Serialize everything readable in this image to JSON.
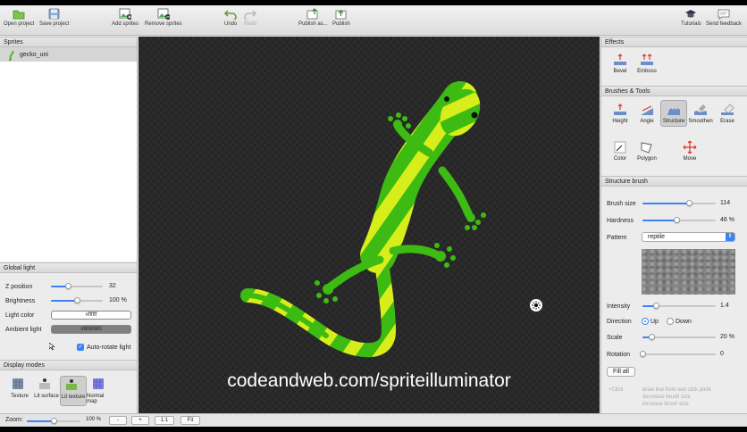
{
  "toolbar": {
    "open_project": "Open project",
    "save_project": "Save project",
    "add_sprites": "Add sprites",
    "remove_sprites": "Remove sprites",
    "undo": "Undo",
    "redo": "Redo",
    "publish_as": "Publish as...",
    "publish": "Publish",
    "tutorials": "Tutorials",
    "send_feedback": "Send feedback"
  },
  "sprites": {
    "header": "Sprites",
    "items": [
      {
        "label": "gecko_uni"
      }
    ]
  },
  "global_light": {
    "header": "Global light",
    "z_position": {
      "label": "Z position",
      "value": "32",
      "level": 0.32
    },
    "brightness": {
      "label": "Brightness",
      "value": "100 %",
      "level": 0.5
    },
    "light_color": {
      "label": "Light color",
      "value": "#ffffff"
    },
    "ambient_light": {
      "label": "Ambient light",
      "value": "#808080"
    },
    "auto_rotate": {
      "label": "Auto-rotate light",
      "checked": true
    }
  },
  "display_modes": {
    "header": "Display modes",
    "items": [
      {
        "label": "Texture"
      },
      {
        "label": "Lit surface"
      },
      {
        "label": "Lit texture"
      },
      {
        "label": "Normal map"
      }
    ],
    "selected": "Lit texture"
  },
  "canvas": {
    "watermark": "codeandweb.com/spriteilluminator"
  },
  "effects": {
    "header": "Effects",
    "items": [
      {
        "label": "Bevel"
      },
      {
        "label": "Emboss"
      }
    ]
  },
  "brushes": {
    "header": "Brushes & Tools",
    "items": [
      {
        "label": "Height"
      },
      {
        "label": "Angle"
      },
      {
        "label": "Structure"
      },
      {
        "label": "Smoothen"
      },
      {
        "label": "Erase"
      },
      {
        "label": "Color"
      },
      {
        "label": "Polygon"
      },
      {
        "label": "Move"
      }
    ],
    "selected": "Structure"
  },
  "structure_brush": {
    "header": "Structure brush",
    "brush_size": {
      "label": "Brush size",
      "value": "114",
      "level": 0.63
    },
    "hardness": {
      "label": "Hardness",
      "value": "46 %",
      "level": 0.46
    },
    "pattern": {
      "label": "Pattern",
      "value": "reptile"
    },
    "intensity": {
      "label": "Intensity",
      "value": "1.4",
      "level": 0.18
    },
    "direction": {
      "label": "Direction",
      "up": "Up",
      "down": "Down",
      "selected": "Up"
    },
    "scale": {
      "label": "Scale",
      "value": "20 %",
      "level": 0.12
    },
    "rotation": {
      "label": "Rotation",
      "value": "0",
      "level": 0.0
    },
    "fill_all": "Fill all",
    "hints": [
      {
        "key": "+Click",
        "text": "draw line from last click point"
      },
      {
        "key": "",
        "text": "decrease brush size"
      },
      {
        "key": "",
        "text": "increase brush size"
      }
    ]
  },
  "statusbar": {
    "zoom_label": "Zoom:",
    "zoom_value": "100 %",
    "zoom_level": 0.5,
    "minus": "-",
    "plus": "+",
    "one_to_one": "1:1",
    "fit": "Fit"
  },
  "colors": {
    "accent": "#3b82f6",
    "gecko_green": "#3dbb12",
    "gecko_yellow": "#d8ee1a",
    "canvas_bg": "#262626"
  }
}
